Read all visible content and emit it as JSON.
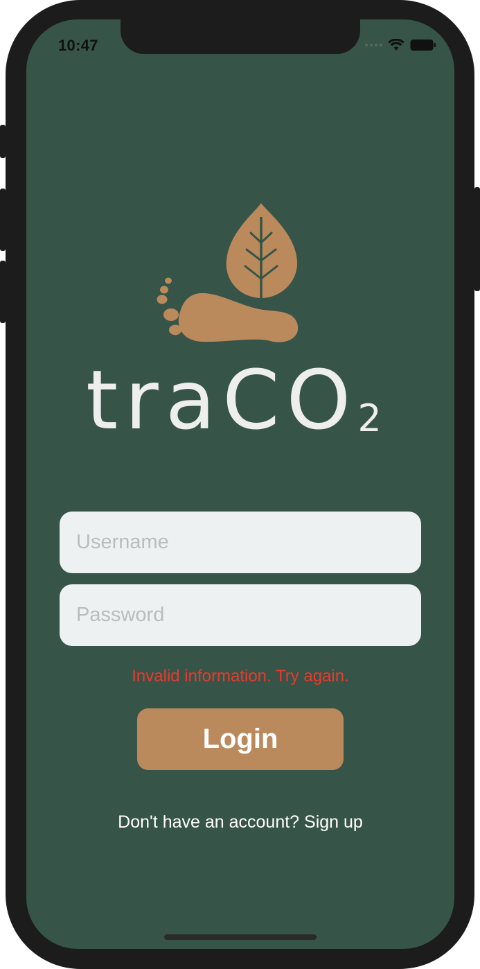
{
  "status_bar": {
    "time": "10:47"
  },
  "logo": {
    "wordmark_main": "traCO",
    "wordmark_sub": "2",
    "icon_name": "foot-leaf-logo"
  },
  "form": {
    "username_placeholder": "Username",
    "password_placeholder": "Password",
    "username_value": "",
    "password_value": "",
    "error_message": "Invalid information. Try again.",
    "login_label": "Login",
    "signup_prompt": "Don't have an account? Sign up"
  },
  "colors": {
    "background": "#365447",
    "accent": "#bb8a5c",
    "input_background": "#eef1f2",
    "error": "#ea3a2e",
    "wordmark": "#eeeeee"
  }
}
